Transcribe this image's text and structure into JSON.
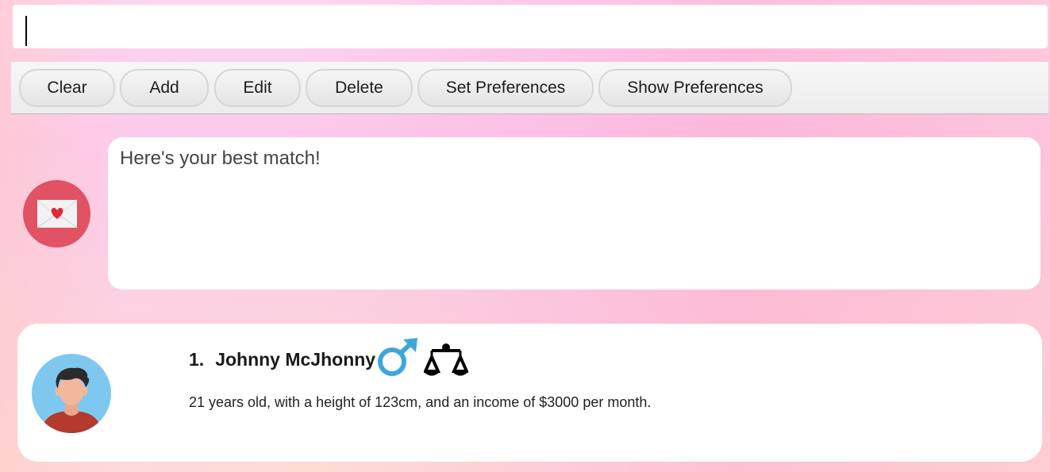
{
  "command_box": {
    "value": ""
  },
  "toolbar": {
    "buttons": [
      {
        "label": "Clear"
      },
      {
        "label": "Add"
      },
      {
        "label": "Edit"
      },
      {
        "label": "Delete"
      },
      {
        "label": "Set Preferences"
      },
      {
        "label": "Show Preferences"
      }
    ]
  },
  "result": {
    "text": "Here's your best match!"
  },
  "colors": {
    "bot_avatar": "#e05264",
    "male_symbol": "#3fa6dc"
  },
  "match_card": {
    "index": "1.",
    "name": "Johnny McJhonny",
    "gender_icon": "male-icon",
    "zodiac_icon": "libra-icon",
    "description": "21 years old, with a height of 123cm, and an income of $3000 per month."
  }
}
